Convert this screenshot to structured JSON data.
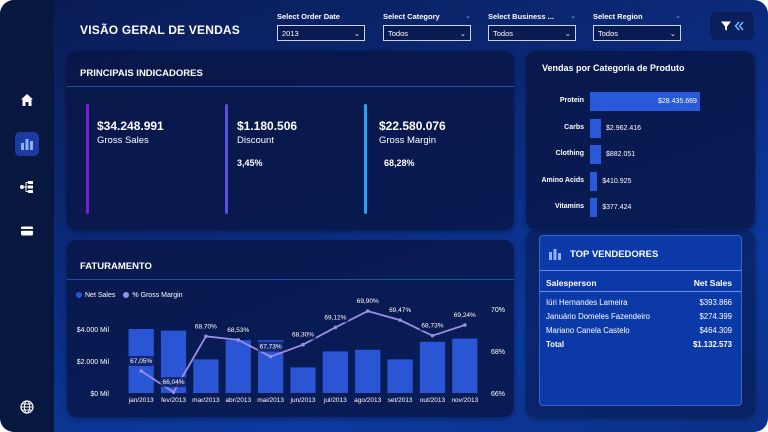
{
  "page": {
    "title": "VISÃO GERAL DE VENDAS"
  },
  "sidebar": {
    "items": [
      {
        "name": "home-icon"
      },
      {
        "name": "bar-chart-icon"
      },
      {
        "name": "hierarchy-icon"
      },
      {
        "name": "card-icon"
      },
      {
        "name": "globe-icon"
      }
    ]
  },
  "filters": [
    {
      "label": "Select Order Date",
      "value": "2013"
    },
    {
      "label": "Select Category",
      "value": "Todos"
    },
    {
      "label": "Select Business ...",
      "value": "Todos"
    },
    {
      "label": "Select Region",
      "value": "Todos"
    }
  ],
  "indicators": {
    "title": "PRINCIPAIS INDICADORES",
    "items": [
      {
        "value": "$34.248.991",
        "label": "Gross Sales",
        "pct": "",
        "color": "#7a1fd6"
      },
      {
        "value": "$1.180.506",
        "label": "Discount",
        "pct": "3,45%",
        "color": "#5b4fe0"
      },
      {
        "value": "$22.580.076",
        "label": "Gross Margin",
        "pct": "68,28%",
        "color": "#2aa4f0"
      }
    ]
  },
  "categories": {
    "title": "Vendas por Categoria de Produto",
    "items": [
      {
        "label": "Protein",
        "value": 28435669,
        "text": "$28.435.669"
      },
      {
        "label": "Carbs",
        "value": 2962416,
        "text": "$2.962.416"
      },
      {
        "label": "Clothing",
        "value": 882051,
        "text": "$882.051"
      },
      {
        "label": "Amino Acids",
        "value": 410925,
        "text": "$410.925"
      },
      {
        "label": "Vitamins",
        "value": 377424,
        "text": "$377.424"
      }
    ]
  },
  "sellers": {
    "title": "TOP VENDEDORES",
    "col_name": "Salesperson",
    "col_value": "Net Sales",
    "rows": [
      {
        "name": "Iúri Hernandes Lameira",
        "value": "$393.866"
      },
      {
        "name": "Januário Domeles Fazendeiro",
        "value": "$274.399"
      },
      {
        "name": "Mariano Canela Castelo",
        "value": "$464.309"
      }
    ],
    "total_label": "Total",
    "total_value": "$1.132.573"
  },
  "chart_data": {
    "type": "bar",
    "title": "FATURAMENTO",
    "categories": [
      "jan/2013",
      "fev/2013",
      "mar/2013",
      "abr/2013",
      "mai/2013",
      "jun/2013",
      "jul/2013",
      "ago/2013",
      "set/2013",
      "out/2013",
      "nov/2013"
    ],
    "series": [
      {
        "name": "Net Sales",
        "type": "bar",
        "axis": "left",
        "color": "#2a55d4",
        "values": [
          4000000,
          3900000,
          2100000,
          3300000,
          3300000,
          1600000,
          2600000,
          2700000,
          2100000,
          3200000,
          3400000
        ]
      },
      {
        "name": "% Gross Margin",
        "type": "line",
        "axis": "right",
        "color": "#9b8ee6",
        "values": [
          67.05,
          66.04,
          68.7,
          68.53,
          67.73,
          68.3,
          69.12,
          69.9,
          69.47,
          68.73,
          69.24
        ],
        "labels": [
          "67,05%",
          "66,04%",
          "68,70%",
          "68,53%",
          "67,73%",
          "68,30%",
          "69,12%",
          "69,90%",
          "69,47%",
          "68,73%",
          "69,24%"
        ]
      }
    ],
    "y_left": {
      "ticks": [
        "$0 Mil",
        "$2.000 Mil",
        "$4.000 Mil"
      ],
      "range": [
        0,
        4000000
      ]
    },
    "y_right": {
      "ticks": [
        "66%",
        "68%",
        "70%"
      ],
      "range": [
        66,
        70
      ]
    },
    "legend": "top-left"
  }
}
